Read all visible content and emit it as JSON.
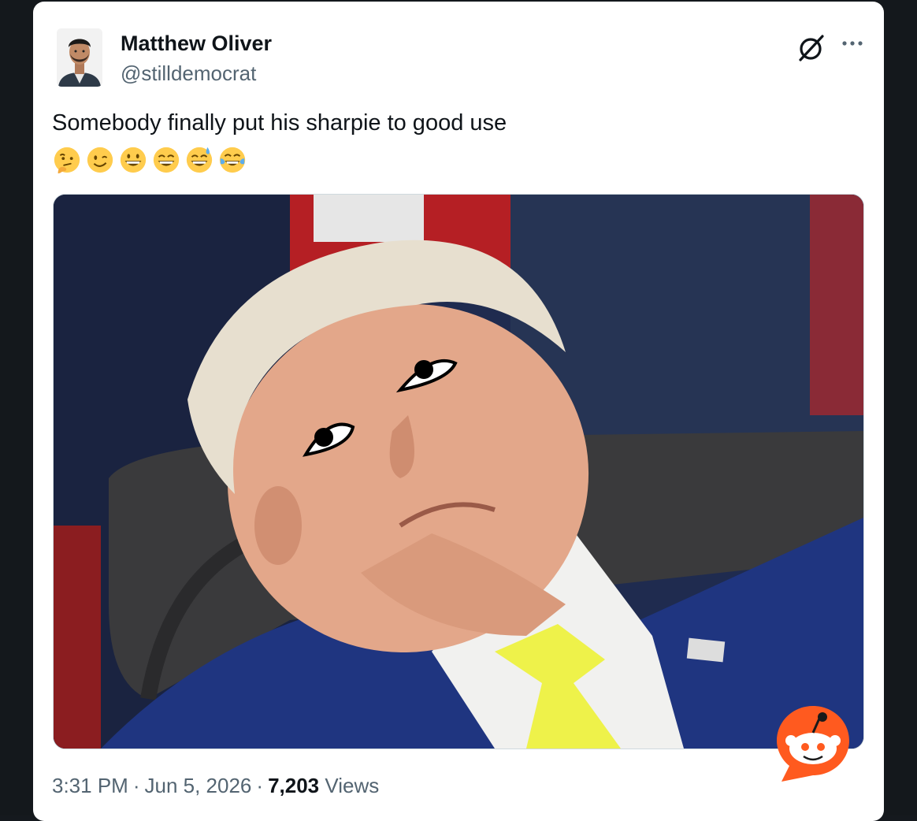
{
  "author": {
    "name": "Matthew Oliver",
    "handle": "@stilldemocrat"
  },
  "tweet": {
    "text": "Somebody finally put his sharpie to good use",
    "emojis": [
      "thinking-face",
      "winking-face",
      "grinning-face-with-big-eyes",
      "grinning-face-squinting",
      "grinning-face-with-sweat",
      "face-with-tears-of-joy"
    ]
  },
  "meta": {
    "time": "3:31 PM",
    "separator": "·",
    "date": "Jun 5, 2026",
    "views_count": "7,203",
    "views_label": "Views"
  },
  "icons": {
    "grok": "grok-icon",
    "more": "more-icon",
    "watermark": "reddit-logo-icon"
  },
  "colors": {
    "text_primary": "#0f1419",
    "text_secondary": "#536471",
    "reddit_orange": "#ff5a1f"
  }
}
